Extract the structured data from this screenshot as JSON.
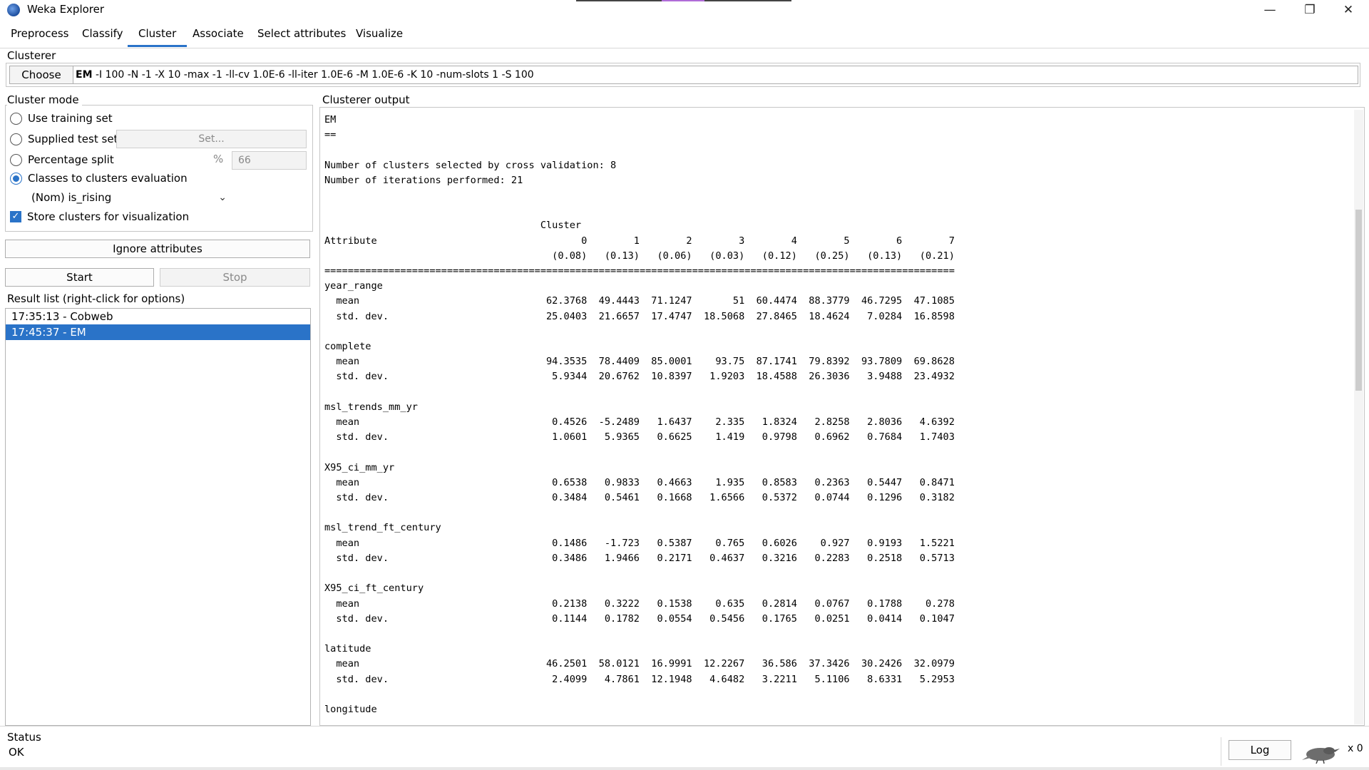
{
  "window": {
    "title": "Weka Explorer",
    "minimize_icon": "minimize-icon",
    "maximize_icon": "restore-icon",
    "close_icon": "close-icon"
  },
  "tabs": [
    {
      "label": "Preprocess",
      "active": false
    },
    {
      "label": "Classify",
      "active": false
    },
    {
      "label": "Cluster",
      "active": true
    },
    {
      "label": "Associate",
      "active": false
    },
    {
      "label": "Select attributes",
      "active": false
    },
    {
      "label": "Visualize",
      "active": false
    }
  ],
  "clusterer": {
    "group_label": "Clusterer",
    "choose_label": "Choose",
    "algorithm": "EM",
    "options": "-I 100 -N -1 -X 10 -max -1 -ll-cv 1.0E-6 -ll-iter 1.0E-6 -M 1.0E-6 -K 10 -num-slots 1 -S 100"
  },
  "cluster_mode": {
    "group_label": "Cluster mode",
    "use_training_set": "Use training set",
    "supplied_test_set": "Supplied test set",
    "set_button": "Set...",
    "percentage_split": "Percentage split",
    "percent_sign": "%",
    "percentage_value": "66",
    "classes_to_clusters": "Classes to clusters evaluation",
    "selected_mode": "Classes to clusters evaluation",
    "class_attribute": "(Nom) is_rising",
    "store_clusters": "Store clusters for visualization",
    "store_clusters_checked": true
  },
  "buttons": {
    "ignore_attributes": "Ignore attributes",
    "start": "Start",
    "stop": "Stop"
  },
  "result_list": {
    "label": "Result list (right-click for options)",
    "items": [
      {
        "label": "17:35:13 - Cobweb",
        "selected": false
      },
      {
        "label": "17:45:37 - EM",
        "selected": true
      }
    ]
  },
  "output": {
    "label": "Clusterer output",
    "header_lines": [
      "EM",
      "==",
      "",
      "Number of clusters selected by cross validation: 8",
      "Number of iterations performed: 21",
      "",
      "",
      "                                     Cluster"
    ],
    "attribute_heading": "Attribute",
    "clusters": [
      "0",
      "1",
      "2",
      "3",
      "4",
      "5",
      "6",
      "7"
    ],
    "priors": [
      "(0.08)",
      "(0.13)",
      "(0.06)",
      "(0.03)",
      "(0.12)",
      "(0.25)",
      "(0.13)",
      "(0.21)"
    ],
    "attributes": [
      {
        "name": "year_range",
        "mean": [
          "62.3768",
          "49.4443",
          "71.1247",
          "51",
          "60.4474",
          "88.3779",
          "46.7295",
          "47.1085"
        ],
        "std": [
          "25.0403",
          "21.6657",
          "17.4747",
          "18.5068",
          "27.8465",
          "18.4624",
          "7.0284",
          "16.8598"
        ]
      },
      {
        "name": "complete",
        "mean": [
          "94.3535",
          "78.4409",
          "85.0001",
          "93.75",
          "87.1741",
          "79.8392",
          "93.7809",
          "69.8628"
        ],
        "std": [
          "5.9344",
          "20.6762",
          "10.8397",
          "1.9203",
          "18.4588",
          "26.3036",
          "3.9488",
          "23.4932"
        ]
      },
      {
        "name": "msl_trends_mm_yr",
        "mean": [
          "0.4526",
          "-5.2489",
          "1.6437",
          "2.335",
          "1.8324",
          "2.8258",
          "2.8036",
          "4.6392"
        ],
        "std": [
          "1.0601",
          "5.9365",
          "0.6625",
          "1.419",
          "0.9798",
          "0.6962",
          "0.7684",
          "1.7403"
        ]
      },
      {
        "name": "X95_ci_mm_yr",
        "mean": [
          "0.6538",
          "0.9833",
          "0.4663",
          "1.935",
          "0.8583",
          "0.2363",
          "0.5447",
          "0.8471"
        ],
        "std": [
          "0.3484",
          "0.5461",
          "0.1668",
          "1.6566",
          "0.5372",
          "0.0744",
          "0.1296",
          "0.3182"
        ]
      },
      {
        "name": "msl_trend_ft_century",
        "mean": [
          "0.1486",
          "-1.723",
          "0.5387",
          "0.765",
          "0.6026",
          "0.927",
          "0.9193",
          "1.5221"
        ],
        "std": [
          "0.3486",
          "1.9466",
          "0.2171",
          "0.4637",
          "0.3216",
          "0.2283",
          "0.2518",
          "0.5713"
        ]
      },
      {
        "name": "X95_ci_ft_century",
        "mean": [
          "0.2138",
          "0.3222",
          "0.1538",
          "0.635",
          "0.2814",
          "0.0767",
          "0.1788",
          "0.278"
        ],
        "std": [
          "0.1144",
          "0.1782",
          "0.0554",
          "0.5456",
          "0.1765",
          "0.0251",
          "0.0414",
          "0.1047"
        ]
      },
      {
        "name": "latitude",
        "mean": [
          "46.2501",
          "58.0121",
          "16.9991",
          "12.2267",
          "36.586",
          "37.3426",
          "30.2426",
          "32.0979"
        ],
        "std": [
          "2.4099",
          "4.7861",
          "12.1948",
          "4.6482",
          "3.2211",
          "5.1106",
          "8.6331",
          "5.2953"
        ]
      },
      {
        "name": "longitude",
        "mean": [],
        "std": []
      }
    ],
    "mean_label": "mean",
    "std_label": "std. dev."
  },
  "status": {
    "label": "Status",
    "text": "OK",
    "log_button": "Log",
    "task_count": "x 0"
  }
}
